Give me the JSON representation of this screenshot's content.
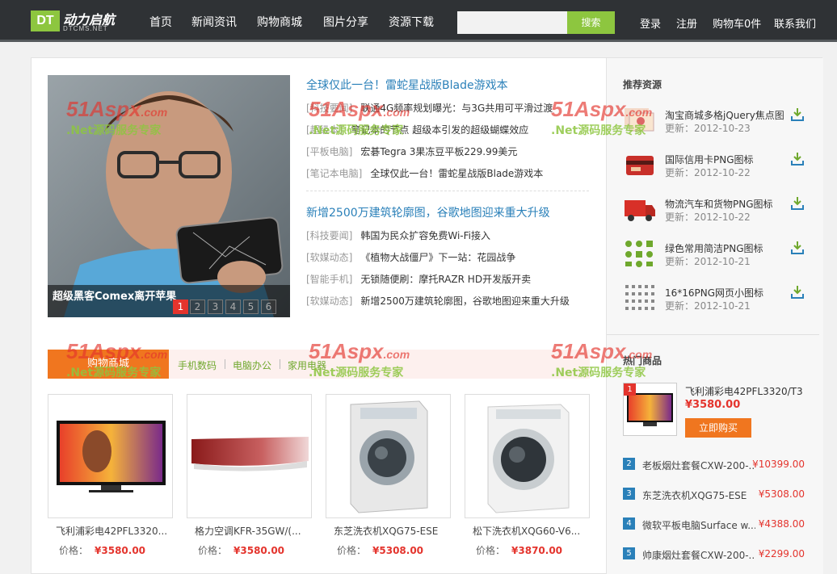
{
  "header": {
    "logo_box": "DT",
    "logo_main": "动力启航",
    "logo_sub": "DTCMS.NET",
    "nav": [
      "首页",
      "新闻资讯",
      "购物商城",
      "图片分享",
      "资源下载"
    ],
    "search_placeholder": "",
    "search_button": "搜索",
    "links": [
      "登录",
      "注册",
      "购物车0件",
      "联系我们"
    ]
  },
  "slider": {
    "caption": "超级黑客Comex离开苹果",
    "pages": [
      "1",
      "2",
      "3",
      "4",
      "5",
      "6"
    ],
    "active_page": 1
  },
  "news": [
    {
      "title": "全球仅此一台！雷蛇星战版Blade游戏本",
      "items": [
        {
          "cat": "[科技要闻]",
          "text": "联通4G频率规划曝光：与3G共用可平滑过渡"
        },
        {
          "cat": "[超级本]",
          "text": "笔记本的节点 超级本引发的超级蝴蝶效应"
        },
        {
          "cat": "[平板电脑]",
          "text": "宏碁Tegra 3果冻豆平板229.99美元"
        },
        {
          "cat": "[笔记本电脑]",
          "text": "全球仅此一台！雷蛇星战版Blade游戏本"
        }
      ]
    },
    {
      "title": "新增2500万建筑轮廓图，谷歌地图迎来重大升级",
      "items": [
        {
          "cat": "[科技要闻]",
          "text": "韩国为民众扩容免费Wi-Fi接入"
        },
        {
          "cat": "[软媒动态]",
          "text": "《植物大战僵尸》下一站：花园战争"
        },
        {
          "cat": "[智能手机]",
          "text": "无锁随便刷：摩托RAZR HD开发版开卖"
        },
        {
          "cat": "[软媒动态]",
          "text": "新增2500万建筑轮廓图，谷歌地图迎来重大升级"
        }
      ]
    }
  ],
  "shop": {
    "tab": "购物商城",
    "categories": [
      "手机数码",
      "电脑办公",
      "家用电器"
    ],
    "price_label": "价格：",
    "products": [
      {
        "name": "飞利浦彩电42PFL3320...",
        "price": "¥3580.00"
      },
      {
        "name": "格力空调KFR-35GW/(...",
        "price": "¥3580.00"
      },
      {
        "name": "东芝洗衣机XQG75-ESE",
        "price": "¥5308.00"
      },
      {
        "name": "松下洗衣机XQG60-V6...",
        "price": "¥3870.00"
      }
    ]
  },
  "sidebar": {
    "recommend_title": "推荐资源",
    "date_label": "更新：",
    "resources": [
      {
        "title": "淘宝商城多格jQuery焦点图",
        "date": "2012-10-23"
      },
      {
        "title": "国际信用卡PNG图标",
        "date": "2012-10-22"
      },
      {
        "title": "物流汽车和货物PNG图标",
        "date": "2012-10-22"
      },
      {
        "title": "绿色常用简洁PNG图标",
        "date": "2012-10-21"
      },
      {
        "title": "16*16PNG网页小图标",
        "date": "2012-10-21"
      }
    ],
    "hot_title": "热门商品",
    "hot_first": {
      "rank": "1",
      "name": "飞利浦彩电42PFL3320/T3",
      "price": "¥3580.00",
      "button": "立即购买"
    },
    "hot_list": [
      {
        "rank": "2",
        "name": "老板烟灶套餐CXW-200-...",
        "price": "¥10399.00"
      },
      {
        "rank": "3",
        "name": "东芝洗衣机XQG75-ESE",
        "price": "¥5308.00"
      },
      {
        "rank": "4",
        "name": "微软平板电脑Surface w...",
        "price": "¥4388.00"
      },
      {
        "rank": "5",
        "name": "帅康烟灶套餐CXW-200-...",
        "price": "¥2299.00"
      }
    ]
  },
  "watermark": {
    "brand": "51Aspx",
    "suffix": ".com",
    "tagline": ".Net源码服务专家"
  },
  "colors": {
    "header_bg": "#2f3235",
    "accent_green": "#8dc63f",
    "accent_orange": "#f0761f",
    "link_blue": "#2a80b9",
    "price_red": "#e4342d"
  }
}
